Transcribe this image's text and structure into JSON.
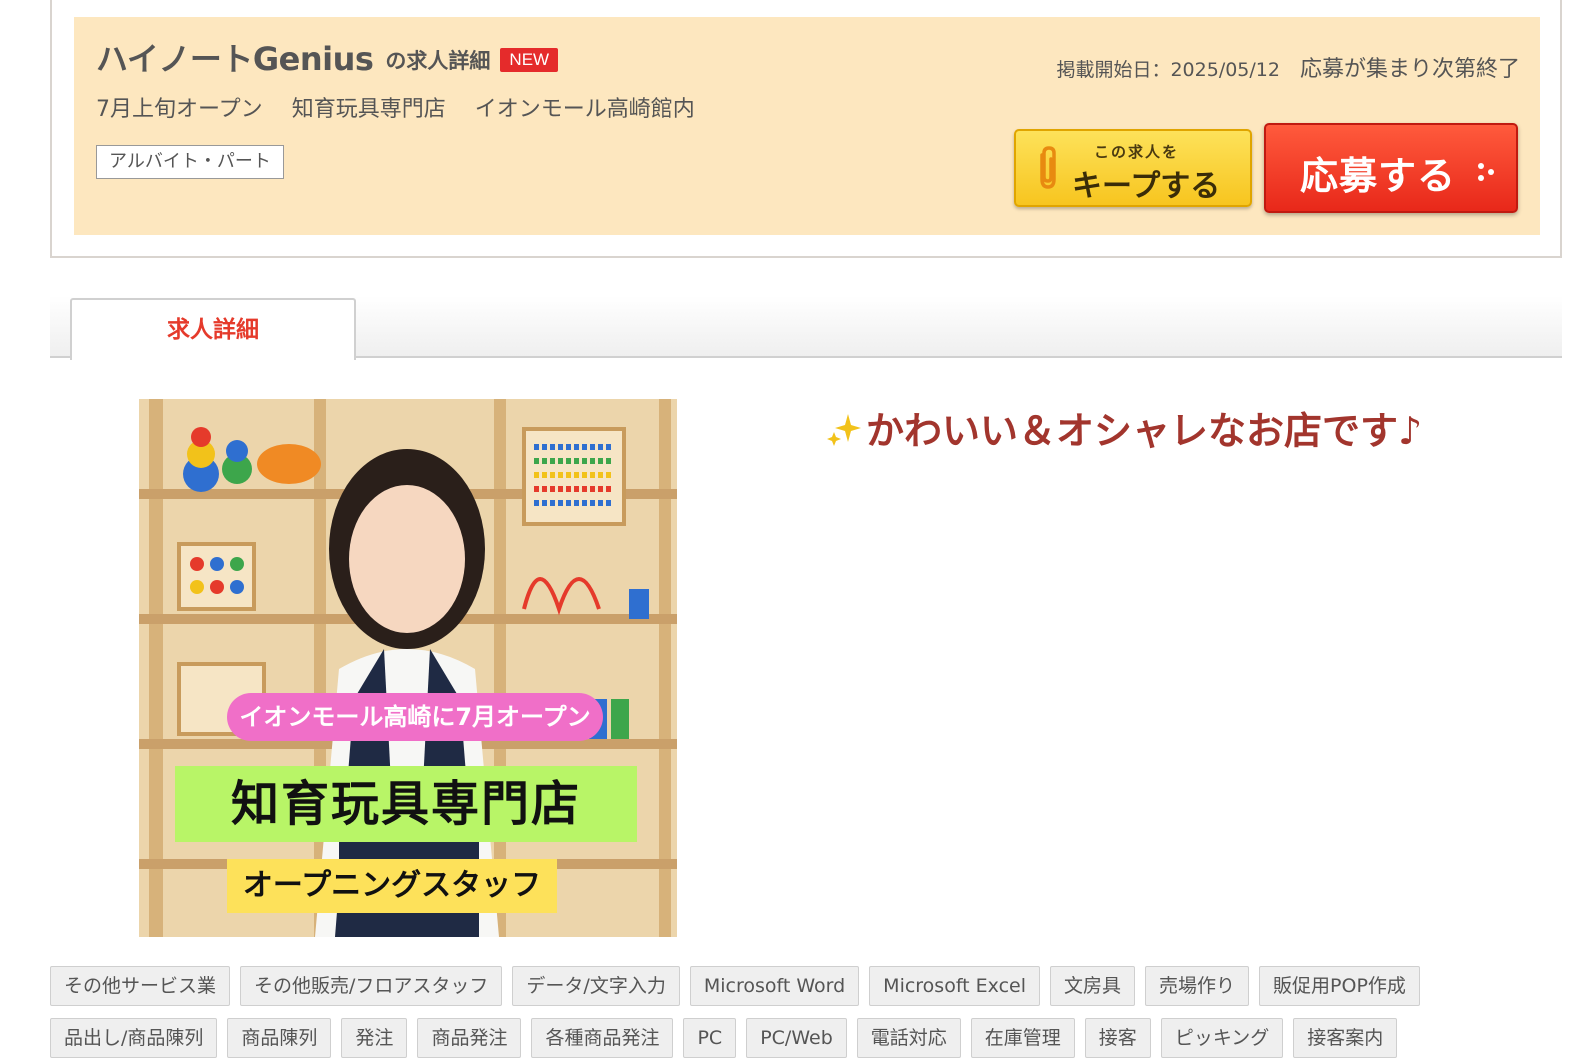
{
  "header": {
    "company_name": "ハイノートGenius",
    "title_suffix": "の求人詳細",
    "new_badge": "NEW",
    "subtitle_parts": [
      "7月上旬オープン",
      "知育玩具専門店",
      "イオンモール高崎館内"
    ],
    "employment_type": "アルバイト・パート",
    "posted_label": "掲載開始日：",
    "posted_date": "2025/05/12",
    "end_label": "応募が集まり次第終了",
    "keep_button": {
      "small": "この求人を",
      "big": "キープする"
    },
    "apply_button": "応募する"
  },
  "tabs": [
    {
      "label": "求人詳細",
      "active": true
    }
  ],
  "photo": {
    "pink_banner": "イオンモール高崎に7月オープン",
    "green_banner": "知育玩具専門店",
    "yellow_banner": "オープニングスタッフ"
  },
  "catch_copy": "かわいい＆オシャレなお店です♪",
  "tags_row1": [
    "その他サービス業",
    "その他販売/フロアスタッフ",
    "データ/文字入力",
    "Microsoft Word",
    "Microsoft Excel",
    "文房具",
    "売場作り",
    "販促用POP作成"
  ],
  "tags_row2": [
    "品出し/商品陳列",
    "商品陳列",
    "発注",
    "商品発注",
    "各種商品発注",
    "PC",
    "PC/Web",
    "電話対応",
    "在庫管理",
    "接客",
    "ピッキング",
    "接客案内"
  ],
  "colors": {
    "header_bg": "#fde7bf",
    "new_badge": "#e52b2b",
    "keep_button": "#f7c51f",
    "apply_button": "#e8281a",
    "tab_active_text": "#e53a2b",
    "catch_copy": "#a2352d"
  },
  "icons": {
    "keep": "paperclip-icon",
    "apply": "dots-icon",
    "catch": "sparkle-icon"
  }
}
